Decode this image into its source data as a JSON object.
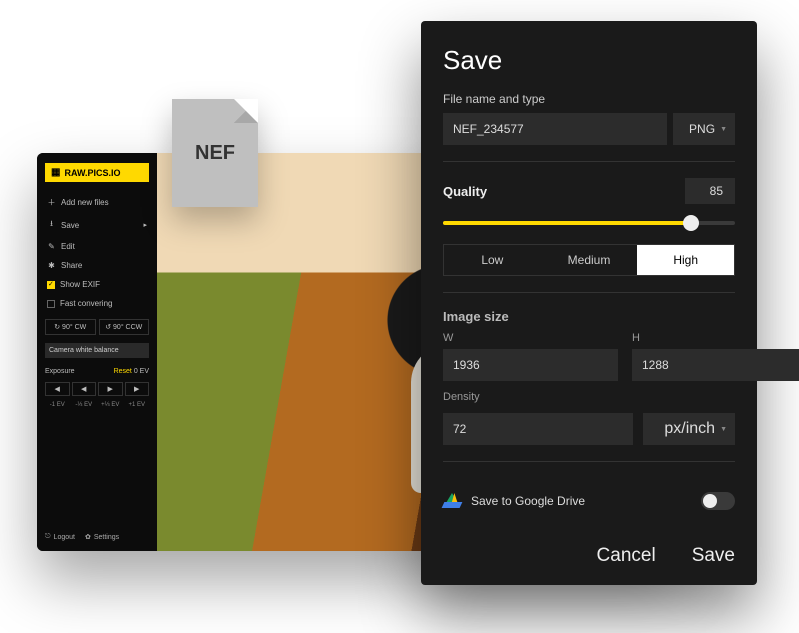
{
  "app": {
    "logo": "RAW.PICS.IO",
    "menu": {
      "add": "Add new files",
      "save": "Save",
      "edit": "Edit",
      "share": "Share",
      "exif": "Show EXIF",
      "fast": "Fast convering"
    },
    "rotate": {
      "cw": "↻ 90° CW",
      "ccw": "↺ 90° CCW"
    },
    "wb": "Camera white balance",
    "exposure": {
      "label": "Exposure",
      "reset": "Reset",
      "reset_val": "0 EV"
    },
    "ev_icons": [
      "◀",
      "◀",
      "▶",
      "▶"
    ],
    "ev_labels": [
      "-1 EV",
      "-⅓ EV",
      "+⅓ EV",
      "+1 EV"
    ],
    "bottom": {
      "logout": "Logout",
      "settings": "Settings"
    }
  },
  "file_badge": "NEF",
  "panel": {
    "title": "Save",
    "filename_label": "File name and type",
    "filename": "NEF_234577",
    "filetype": "PNG",
    "quality": {
      "label": "Quality",
      "value": "85",
      "options": [
        "Low",
        "Medium",
        "High"
      ],
      "active": "High"
    },
    "size": {
      "label": "Image size",
      "w_label": "W",
      "w": "1936",
      "h_label": "H",
      "h": "1288",
      "density_label": "Density",
      "density": "72",
      "density_unit": "px/inch"
    },
    "gdrive": "Save to Google Drive",
    "actions": {
      "cancel": "Cancel",
      "save": "Save"
    }
  }
}
